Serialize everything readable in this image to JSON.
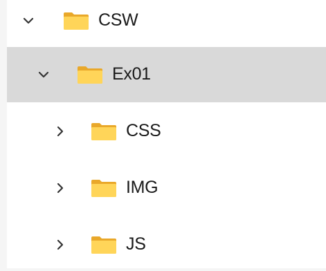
{
  "tree": {
    "items": [
      {
        "label": "CSW",
        "expanded": true,
        "selected": false,
        "icon": "folder-icon",
        "chevron": "chevron-down-icon"
      },
      {
        "label": "Ex01",
        "expanded": true,
        "selected": true,
        "icon": "folder-icon",
        "chevron": "chevron-down-icon"
      },
      {
        "label": "CSS",
        "expanded": false,
        "selected": false,
        "icon": "folder-icon",
        "chevron": "chevron-right-icon"
      },
      {
        "label": "IMG",
        "expanded": false,
        "selected": false,
        "icon": "folder-icon",
        "chevron": "chevron-right-icon"
      },
      {
        "label": "JS",
        "expanded": false,
        "selected": false,
        "icon": "folder-icon",
        "chevron": "chevron-right-icon"
      }
    ],
    "colors": {
      "selection": "#d9d9d9",
      "folder_body": "#ffd559",
      "folder_tab": "#e9a82a",
      "chevron": "#333333"
    }
  }
}
